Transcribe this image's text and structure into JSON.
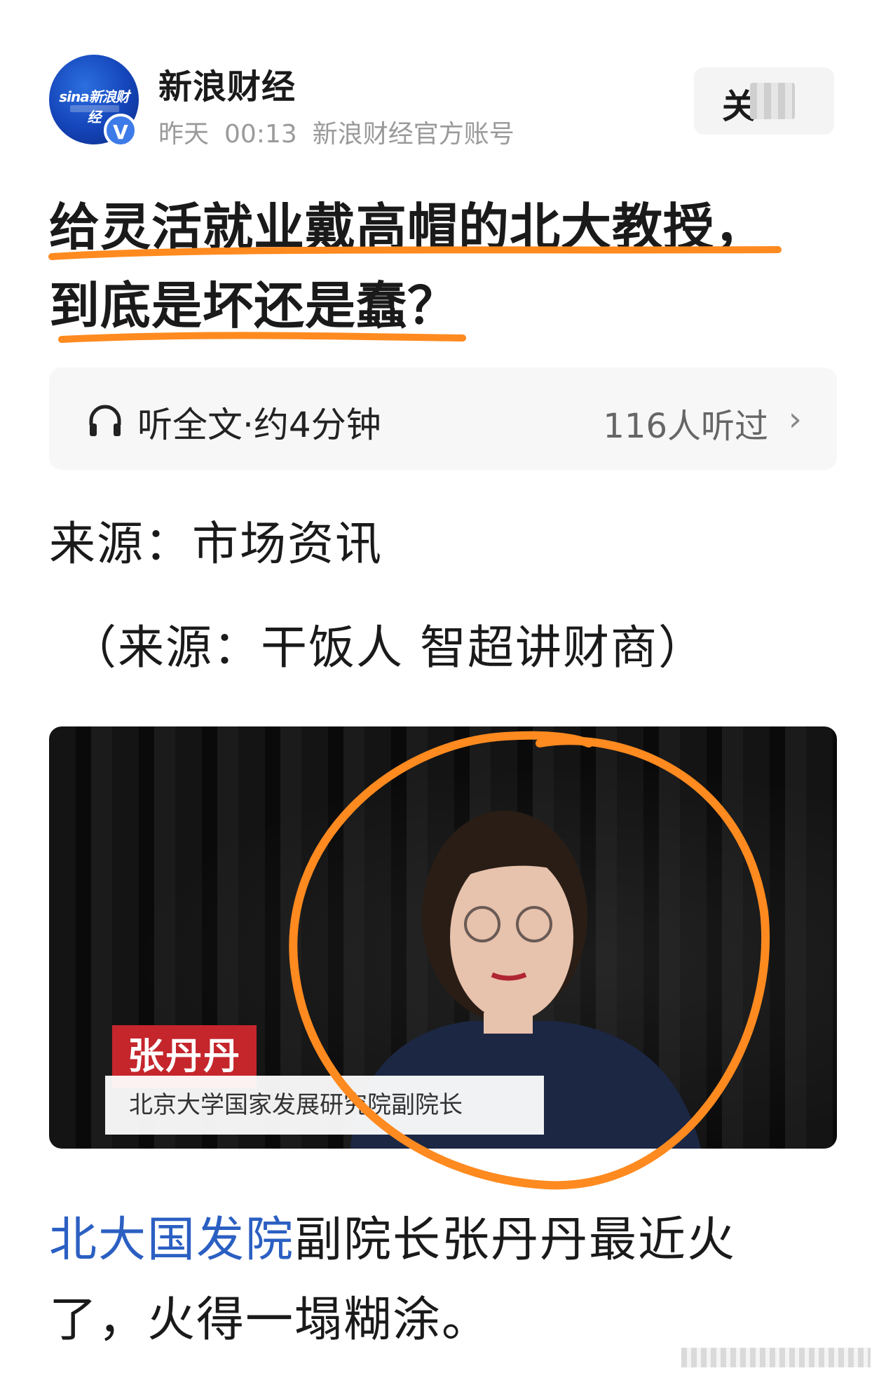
{
  "account": {
    "name": "新浪财经",
    "date": "昨天",
    "time": "00:13",
    "description": "新浪财经官方账号",
    "avatar_logo": "sina新浪财经",
    "verified_mark": "V"
  },
  "follow_button": {
    "label": "关"
  },
  "article": {
    "title_line1": "给灵活就业戴高帽的北大教授，",
    "title_line2": "到底是坏还是蠢？"
  },
  "listen": {
    "label": "听全文·约4分钟",
    "count": "116人听过",
    "chevron": "›",
    "icon": "headphone-icon"
  },
  "source": {
    "line": "来源：市场资讯",
    "sub": "（来源：干饭人 智超讲财商）"
  },
  "photo": {
    "person_name": "张丹丹",
    "person_title": "北京大学国家发展研究院副院长"
  },
  "body": {
    "link_text": "北大国发院",
    "rest_line1": "副院长张丹丹最近火",
    "line2": "了，火得一塌糊涂。"
  },
  "colors": {
    "annotation": "#ff8a1f",
    "link": "#2b5fc2",
    "name_tag": "#c4262c"
  }
}
